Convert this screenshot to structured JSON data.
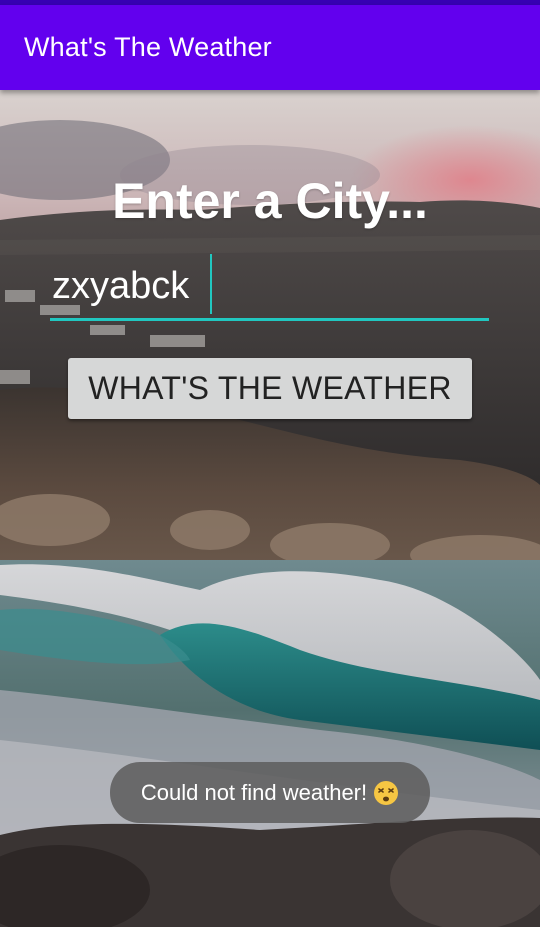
{
  "app": {
    "title": "What's The Weather"
  },
  "main": {
    "heading": "Enter a City...",
    "city_input": {
      "value": "zxyabck",
      "placeholder": ""
    },
    "weather_button_label": "WHAT'S THE WEATHER"
  },
  "toast": {
    "message": "Could not find weather!",
    "icon": "dizzy-face-emoji-icon"
  },
  "colors": {
    "status_bar": "#3700b3",
    "app_bar": "#6200ee",
    "input_accent": "#21c7c0",
    "button_background": "#d6d7d7",
    "toast_background": "#5f5f5f"
  },
  "background": {
    "scene": "coastal cliff with ocean waves",
    "icon": "background-photo"
  }
}
